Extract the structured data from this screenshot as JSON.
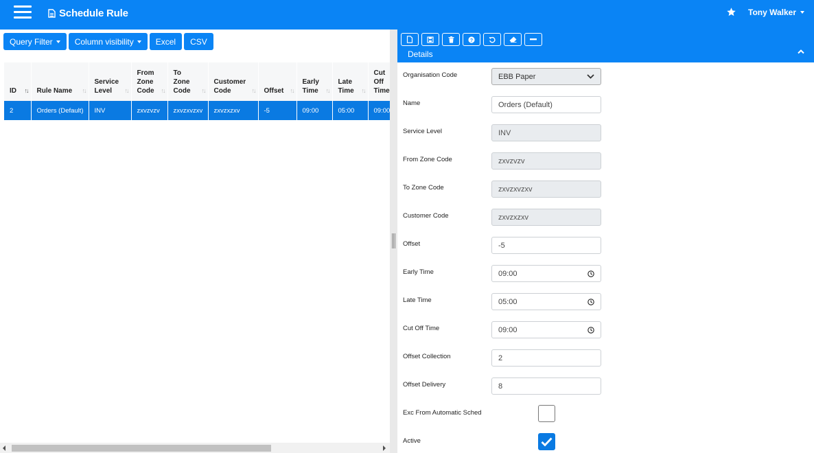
{
  "header": {
    "title": "Schedule Rule",
    "user_name": "Tony Walker"
  },
  "toolbar": {
    "query_filter_label": "Query Filter",
    "column_visibility_label": "Column visibility",
    "excel_label": "Excel",
    "csv_label": "CSV"
  },
  "grid": {
    "columns": [
      {
        "l1": "ID",
        "l2": "",
        "l3": ""
      },
      {
        "l1": "Rule Name",
        "l2": "",
        "l3": ""
      },
      {
        "l1": "Service",
        "l2": "Level",
        "l3": ""
      },
      {
        "l1": "From",
        "l2": "Zone",
        "l3": "Code"
      },
      {
        "l1": "To",
        "l2": "Zone",
        "l3": "Code"
      },
      {
        "l1": "Customer",
        "l2": "Code",
        "l3": ""
      },
      {
        "l1": "Offset",
        "l2": "",
        "l3": ""
      },
      {
        "l1": "Early",
        "l2": "Time",
        "l3": ""
      },
      {
        "l1": "Late",
        "l2": "Time",
        "l3": ""
      },
      {
        "l1": "Cut",
        "l2": "Off",
        "l3": "Time"
      }
    ],
    "rows": [
      [
        "2",
        "Orders (Default)",
        "INV",
        "zxvzvzv",
        "zxvzxvzxv",
        "zxvzxzxv",
        "-5",
        "09:00",
        "05:00",
        "09:00"
      ]
    ]
  },
  "details": {
    "title": "Details",
    "fields": {
      "organisation_code": {
        "label": "Organisation Code",
        "value": "EBB Paper"
      },
      "name": {
        "label": "Name",
        "value": "Orders (Default)"
      },
      "service_level": {
        "label": "Service Level",
        "value": "INV"
      },
      "from_zone_code": {
        "label": "From Zone Code",
        "value": "zxvzvzv"
      },
      "to_zone_code": {
        "label": "To Zone Code",
        "value": "zxvzxvzxv"
      },
      "customer_code": {
        "label": "Customer Code",
        "value": "zxvzxzxv"
      },
      "offset": {
        "label": "Offset",
        "value": "-5"
      },
      "early_time": {
        "label": "Early Time",
        "value": "09:00"
      },
      "late_time": {
        "label": "Late Time",
        "value": "05:00"
      },
      "cut_off_time": {
        "label": "Cut Off Time",
        "value": "09:00"
      },
      "offset_collection": {
        "label": "Offset Collection",
        "value": "2"
      },
      "offset_delivery": {
        "label": "Offset Delivery",
        "value": "8"
      },
      "exc_from_automatic_sched": {
        "label": "Exc From Automatic Sched",
        "checked": false
      },
      "active": {
        "label": "Active",
        "checked": true
      }
    }
  }
}
